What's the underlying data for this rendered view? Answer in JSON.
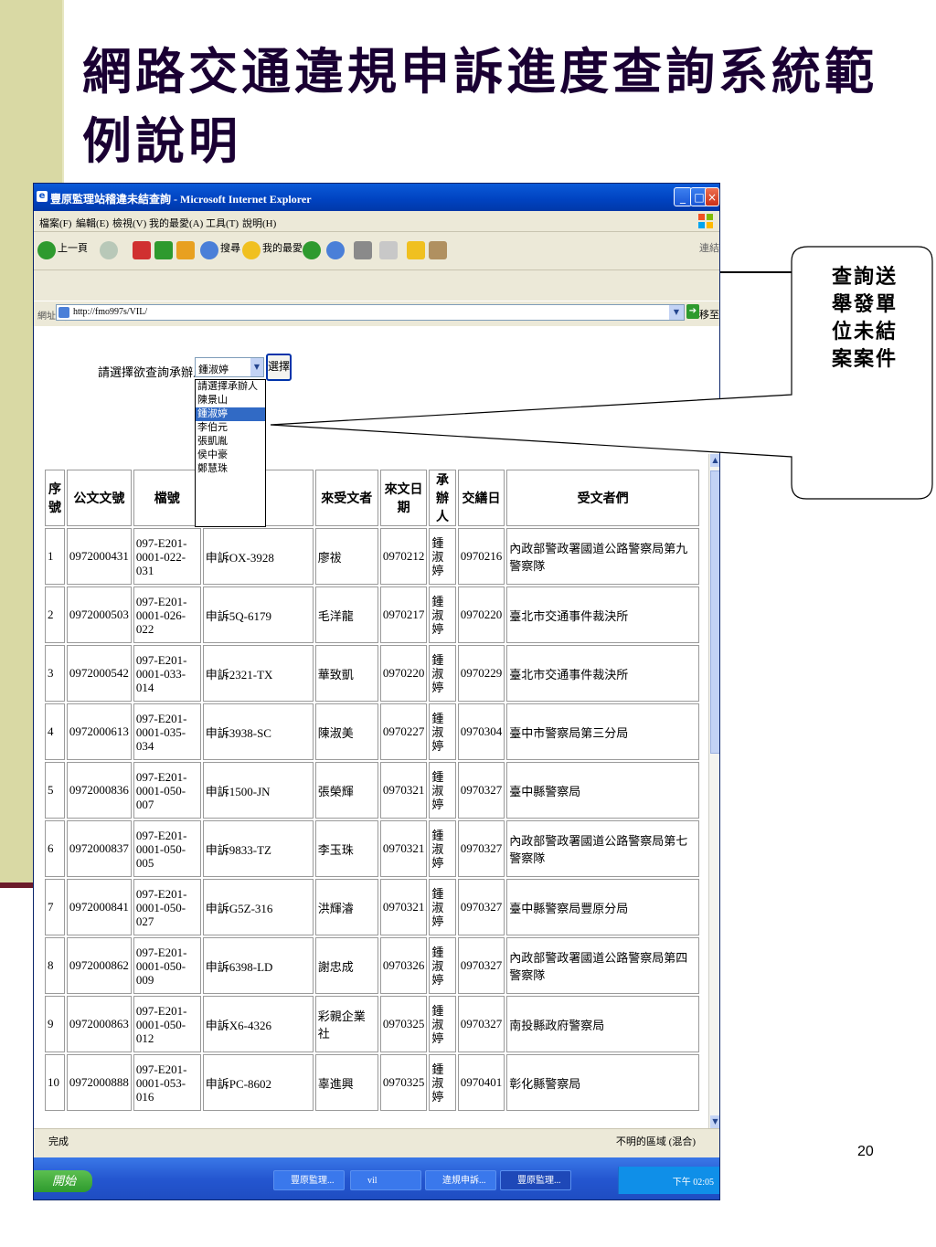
{
  "slide": {
    "title": "網路交通違規申訴進度查詢系統範例說明",
    "page_number": "20",
    "callout_text": "查詢送舉發單位未結案案件"
  },
  "browser": {
    "title": "豐原監理站稽違未結查詢 - Microsoft Internet Explorer",
    "menu": [
      "檔案(F)",
      "編輯(E)",
      "檢視(V)",
      "我的最愛(A)",
      "工具(T)",
      "說明(H)"
    ],
    "toolbar": {
      "back": "上一頁",
      "search": "搜尋",
      "favorites": "我的最愛",
      "links": "連結"
    },
    "address_label": "網址(D)",
    "url": "http://fmo997s/VIL/",
    "go": "移至",
    "status": "完成",
    "zone": "不明的區域 (混合)"
  },
  "form": {
    "label": "請選擇欲查詢承辦人",
    "selected": "鍾淑婷",
    "button": "選擇",
    "options": [
      "請選擇承辦人",
      "陳景山",
      "鍾淑婷",
      "李伯元",
      "張凱胤",
      "侯中豪",
      "鄭慧珠"
    ],
    "selected_index": 2
  },
  "table": {
    "headers": [
      "序號",
      "公文文號",
      "檔號",
      "",
      "來受文者",
      "來文日期",
      "承辦人",
      "交繕日",
      "受文者們"
    ],
    "rows": [
      {
        "no": "1",
        "doc": "0972000431",
        "file": "097-E201-0001-022-031",
        "case": "申訴OX-3928",
        "sender": "廖祓",
        "recv": "0970212",
        "staff": "鍾淑婷",
        "sent": "0970216",
        "to": "內政部警政署國道公路警察局第九警察隊"
      },
      {
        "no": "2",
        "doc": "0972000503",
        "file": "097-E201-0001-026-022",
        "case": "申訴5Q-6179",
        "sender": "毛洋龍",
        "recv": "0970217",
        "staff": "鍾淑婷",
        "sent": "0970220",
        "to": "臺北市交通事件裁決所"
      },
      {
        "no": "3",
        "doc": "0972000542",
        "file": "097-E201-0001-033-014",
        "case": "申訴2321-TX",
        "sender": "華致凱",
        "recv": "0970220",
        "staff": "鍾淑婷",
        "sent": "0970229",
        "to": "臺北市交通事件裁決所"
      },
      {
        "no": "4",
        "doc": "0972000613",
        "file": "097-E201-0001-035-034",
        "case": "申訴3938-SC",
        "sender": "陳淑美",
        "recv": "0970227",
        "staff": "鍾淑婷",
        "sent": "0970304",
        "to": "臺中市警察局第三分局"
      },
      {
        "no": "5",
        "doc": "0972000836",
        "file": "097-E201-0001-050-007",
        "case": "申訴1500-JN",
        "sender": "張榮輝",
        "recv": "0970321",
        "staff": "鍾淑婷",
        "sent": "0970327",
        "to": "臺中縣警察局"
      },
      {
        "no": "6",
        "doc": "0972000837",
        "file": "097-E201-0001-050-005",
        "case": "申訴9833-TZ",
        "sender": "李玉珠",
        "recv": "0970321",
        "staff": "鍾淑婷",
        "sent": "0970327",
        "to": "內政部警政署國道公路警察局第七警察隊"
      },
      {
        "no": "7",
        "doc": "0972000841",
        "file": "097-E201-0001-050-027",
        "case": "申訴G5Z-316",
        "sender": "洪輝濬",
        "recv": "0970321",
        "staff": "鍾淑婷",
        "sent": "0970327",
        "to": "臺中縣警察局豐原分局"
      },
      {
        "no": "8",
        "doc": "0972000862",
        "file": "097-E201-0001-050-009",
        "case": "申訴6398-LD",
        "sender": "謝忠成",
        "recv": "0970326",
        "staff": "鍾淑婷",
        "sent": "0970327",
        "to": "內政部警政署國道公路警察局第四警察隊"
      },
      {
        "no": "9",
        "doc": "0972000863",
        "file": "097-E201-0001-050-012",
        "case": "申訴X6-4326",
        "sender": "彩親企業社",
        "recv": "0970325",
        "staff": "鍾淑婷",
        "sent": "0970327",
        "to": "南投縣政府警察局"
      },
      {
        "no": "10",
        "doc": "0972000888",
        "file": "097-E201-0001-053-016",
        "case": "申訴PC-8602",
        "sender": "辜進興",
        "recv": "0970325",
        "staff": "鍾淑婷",
        "sent": "0970401",
        "to": "彰化縣警察局"
      }
    ]
  },
  "taskbar": {
    "start": "開始",
    "tasks": [
      "豐原監理...",
      "vil",
      "違規申訴...",
      "豐原監理..."
    ],
    "clock": "下午 02:05"
  },
  "colors": {
    "title": "#1a0033",
    "sidebar": "#d9d9a4",
    "accent_line": "#6b1b2a",
    "xp_blue": "#0a5ad8"
  }
}
